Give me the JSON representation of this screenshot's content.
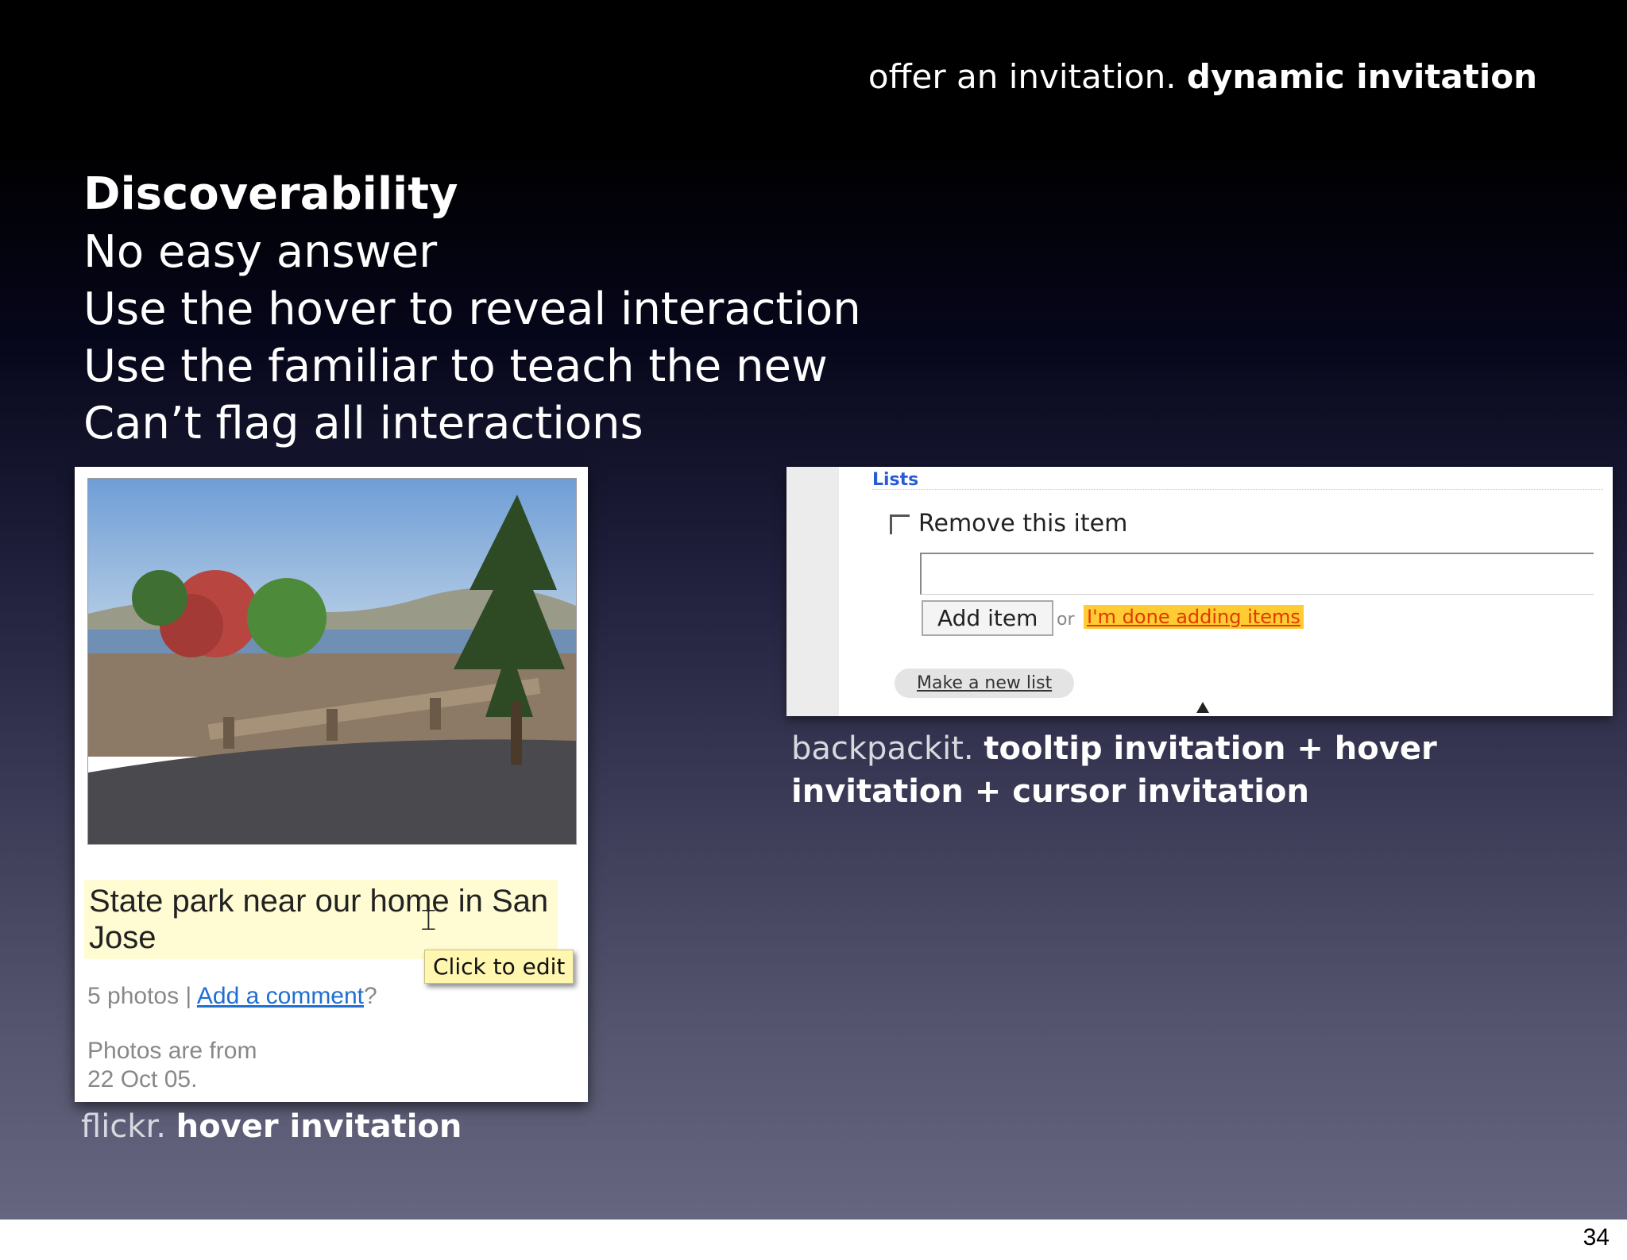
{
  "header": {
    "light": "offer an invitation.",
    "bold": "dynamic invitation"
  },
  "title": "Discoverability",
  "bullets": [
    "No easy answer",
    "Use the hover to reveal interaction",
    "Use the familiar to teach the new",
    "Can’t flag all interactions"
  ],
  "flickr": {
    "photo_title": "State park near our home in San Jose",
    "tooltip": "Click to edit",
    "photos_count": "5 photos",
    "separator": " | ",
    "add_comment": "Add a comment",
    "question": "?",
    "photos_from_line1": "Photos are from",
    "photos_from_line2": "22 Oct 05.",
    "caption_dim": "flickr.",
    "caption_strong": "hover invitation"
  },
  "backpack": {
    "lists_label": "Lists",
    "remove_label": "Remove this item",
    "add_button": "Add item",
    "or_text": "or",
    "done_link": "I'm done adding items",
    "new_list": "Make a new list",
    "caption_dim": "backpackit.",
    "caption_strong": "tooltip invitation + hover invitation + cursor invitation"
  },
  "page_number": "34"
}
